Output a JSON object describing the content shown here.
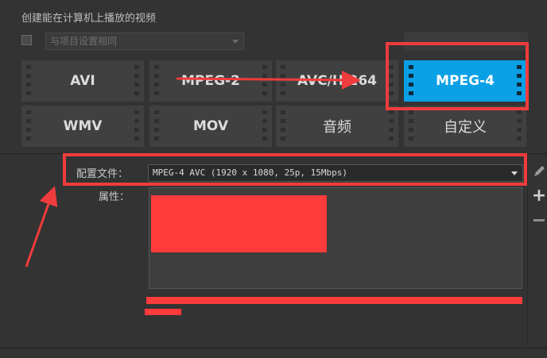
{
  "section_title": "创建能在计算机上播放的视频",
  "same_as_project": {
    "checked": false,
    "placeholder": "与项目设置相同"
  },
  "formats": [
    {
      "label": "AVI",
      "selected": false
    },
    {
      "label": "MPEG-2",
      "selected": false
    },
    {
      "label": "AVC/H.264",
      "selected": false
    },
    {
      "label": "MPEG-4",
      "selected": true
    },
    {
      "label": "WMV",
      "selected": false
    },
    {
      "label": "MOV",
      "selected": false
    },
    {
      "label": "音频",
      "selected": false
    },
    {
      "label": "自定义",
      "selected": false
    }
  ],
  "profile": {
    "label": "配置文件：",
    "value": "MPEG-4 AVC (1920 x 1080, 25p, 15Mbps)"
  },
  "properties": {
    "label": "属性："
  },
  "icons": [
    "pencil-icon",
    "plus-icon",
    "minus-icon"
  ],
  "colors": {
    "accent": "#0aa0e6",
    "annotation": "#f03c3c",
    "background": "#333333"
  }
}
